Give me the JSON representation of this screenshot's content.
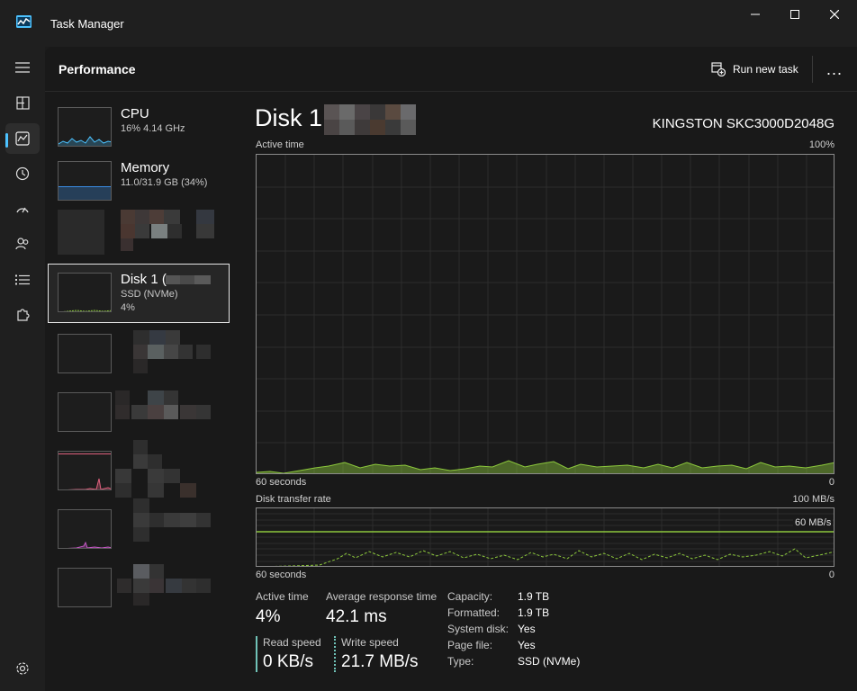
{
  "window": {
    "title": "Task Manager"
  },
  "header": {
    "page_title": "Performance",
    "run_new_task": "Run new task",
    "more": "..."
  },
  "devices": [
    {
      "name": "CPU",
      "sub": "16%  4.14 GHz"
    },
    {
      "name": "Memory",
      "sub": "11.0/31.9 GB (34%)"
    },
    {
      "name": "Disk 1 (",
      "sub1": "SSD (NVMe)",
      "sub2": "4%"
    }
  ],
  "main": {
    "title": "Disk 1",
    "model": "KINGSTON SKC3000D2048G",
    "active_time_label": "Active time",
    "active_time_max": "100%",
    "sixty_seconds": "60 seconds",
    "zero": "0",
    "transfer_label": "Disk transfer rate",
    "transfer_max": "100 MB/s",
    "transfer_marker": "60 MB/s"
  },
  "stats": {
    "active_time_label": "Active time",
    "active_time_value": "4%",
    "avg_response_label": "Average response time",
    "avg_response_value": "42.1 ms",
    "read_label": "Read speed",
    "read_value": "0 KB/s",
    "write_label": "Write speed",
    "write_value": "21.7 MB/s"
  },
  "properties": [
    {
      "key": "Capacity:",
      "value": "1.9 TB"
    },
    {
      "key": "Formatted:",
      "value": "1.9 TB"
    },
    {
      "key": "System disk:",
      "value": "Yes"
    },
    {
      "key": "Page file:",
      "value": "Yes"
    },
    {
      "key": "Type:",
      "value": "SSD (NVMe)"
    }
  ],
  "colors": {
    "disk_accent": "#8cc83c",
    "cpu_accent": "#4cc2ff",
    "memory_accent": "#3a8ee6",
    "gpu_accent": "#e0607e",
    "panel_bg": "#191919"
  }
}
